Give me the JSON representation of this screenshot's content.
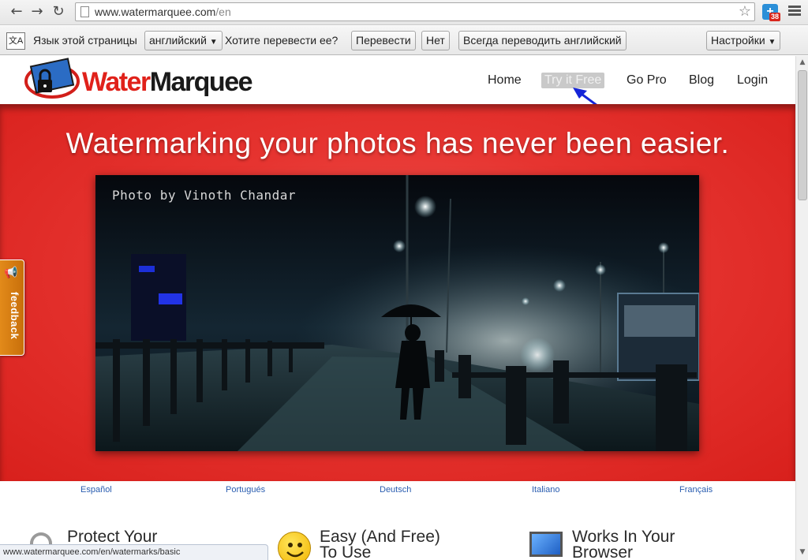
{
  "browser": {
    "url_host": "www.watermarquee.com",
    "url_path": "/en",
    "extension_badge": "38",
    "status_url": "www.watermarquee.com/en/watermarks/basic"
  },
  "translate_bar": {
    "page_language_label": "Язык этой страницы",
    "language_value": "английский",
    "question": "Хотите перевести ее?",
    "translate_button": "Перевести",
    "no_button": "Нет",
    "always_button": "Всегда переводить английский",
    "settings_button": "Настройки"
  },
  "site": {
    "logo_water": "Water",
    "logo_marquee": "Marquee",
    "nav": {
      "home": "Home",
      "try_free": "Try it Free",
      "go_pro": "Go Pro",
      "blog": "Blog",
      "login": "Login"
    },
    "hero_title": "Watermarking your photos has never been easier.",
    "photo_credit": "Photo by Vinoth Chandar",
    "languages": [
      "Español",
      "Portugués",
      "Deutsch",
      "Italiano",
      "Français"
    ],
    "features": [
      {
        "line1": "Protect Your",
        "line2": ""
      },
      {
        "line1": "Easy (And Free)",
        "line2": "To Use"
      },
      {
        "line1": "Works In Your",
        "line2": "Browser"
      }
    ],
    "feedback_label": "feedback"
  },
  "colors": {
    "brand_red": "#e0211a",
    "hero_red": "#e63430",
    "link_blue": "#2a5db0",
    "feedback_orange": "#e28a1a"
  }
}
